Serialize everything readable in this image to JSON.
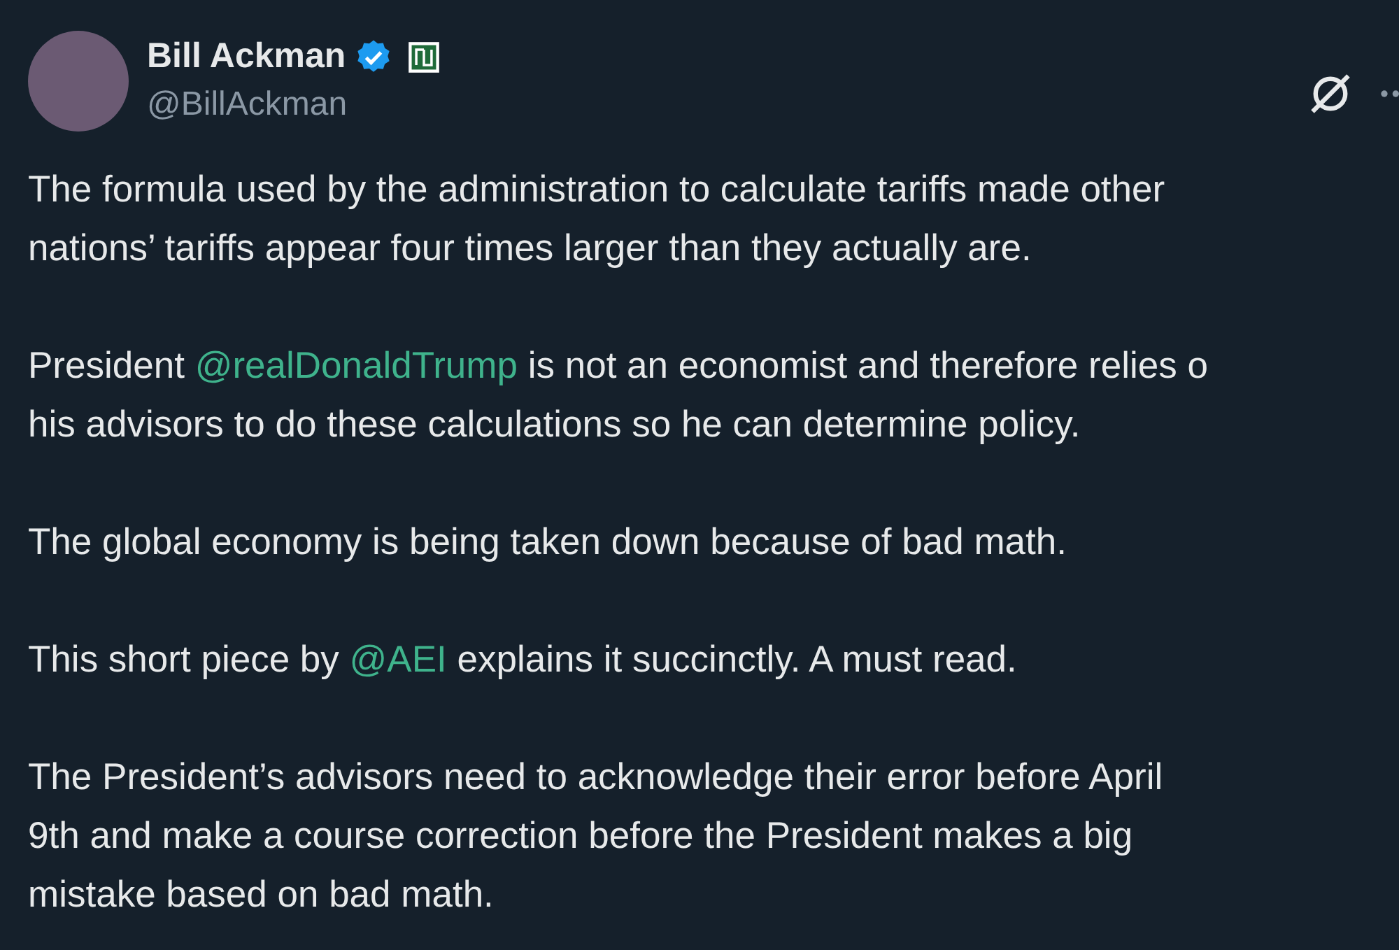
{
  "author": {
    "name": "Bill Ackman",
    "verified": true,
    "handle": "@BillAckman"
  },
  "paragraphs": [
    {
      "lines": [
        [
          {
            "kind": "text",
            "text": "The formula used by the administration  to calculate tariffs made other"
          }
        ],
        [
          {
            "kind": "text",
            "text": "nations’ tariffs appear four times larger than they actually are."
          }
        ]
      ]
    },
    {
      "lines": [
        [
          {
            "kind": "text",
            "text": "President "
          },
          {
            "kind": "mention",
            "text": "@realDonaldTrump"
          },
          {
            "kind": "text",
            "text": " is not an economist and therefore relies o"
          }
        ],
        [
          {
            "kind": "text",
            "text": "his advisors to do these calculations so he can determine policy."
          }
        ]
      ]
    },
    {
      "lines": [
        [
          {
            "kind": "text",
            "text": "The global economy is being taken down because of bad math."
          }
        ]
      ]
    },
    {
      "lines": [
        [
          {
            "kind": "text",
            "text": "This short piece by "
          },
          {
            "kind": "mention",
            "text": "@AEI"
          },
          {
            "kind": "text",
            "text": " explains it succinctly. A must read."
          }
        ]
      ]
    },
    {
      "lines": [
        [
          {
            "kind": "text",
            "text": "The President’s advisors need to acknowledge their error before April"
          }
        ],
        [
          {
            "kind": "text",
            "text": "9th and make a course correction before the President makes a big"
          }
        ],
        [
          {
            "kind": "text",
            "text": "mistake based on bad math."
          }
        ]
      ]
    }
  ]
}
